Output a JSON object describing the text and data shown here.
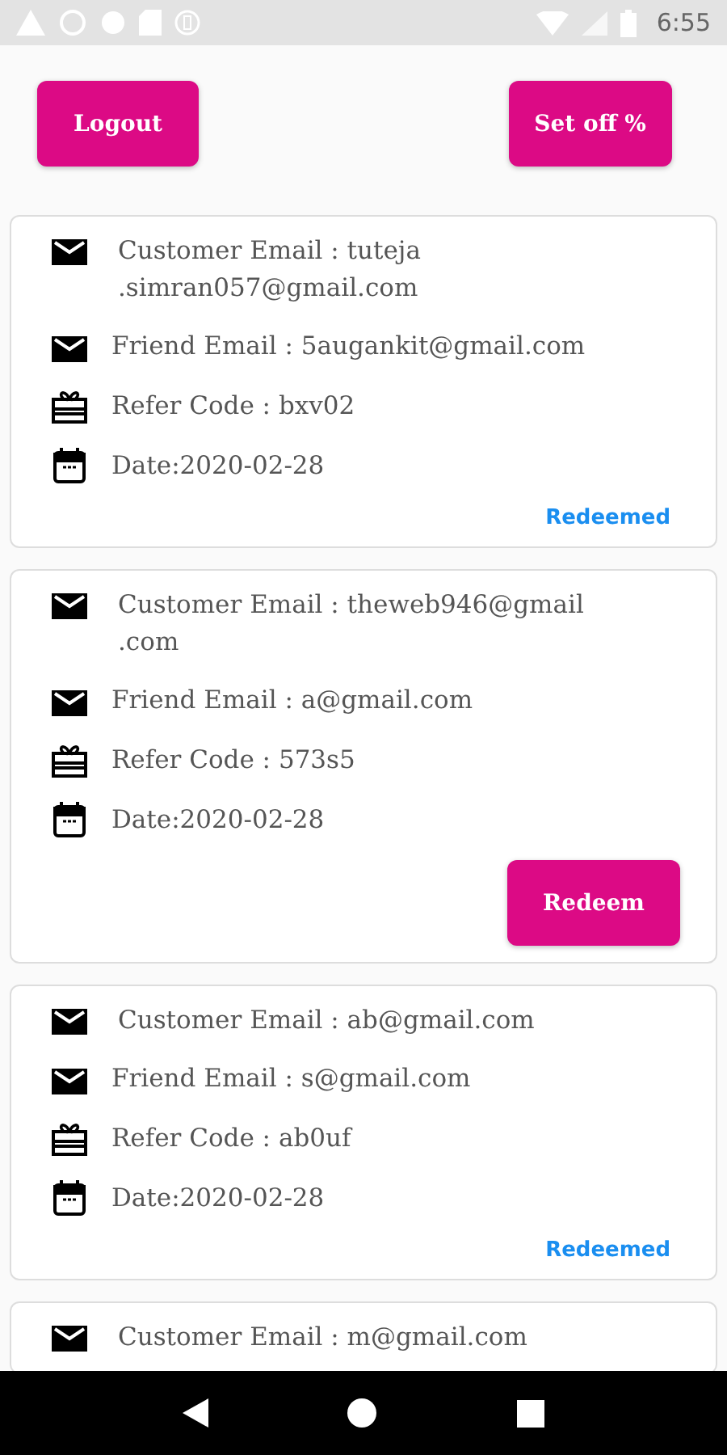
{
  "status_bar": {
    "time": "6:55"
  },
  "header": {
    "buttons": [
      "Logout",
      "Set off %"
    ]
  },
  "referrals": [
    {
      "customer_email": "Customer Email : tuteja .simran057@gmail.com",
      "friend_email": "Friend Email : 5augankit@gmail.com",
      "refer_code": "Refer Code : bxv02",
      "date": "Date:2020-02-28",
      "action": {
        "kind": "status",
        "label": "Redeemed"
      }
    },
    {
      "customer_email": "Customer Email : theweb946@gmail .com",
      "friend_email": "Friend Email : a@gmail.com",
      "refer_code": "Refer Code : 573s5",
      "date": "Date:2020-02-28",
      "action": {
        "kind": "button",
        "label": "Redeem"
      }
    },
    {
      "customer_email": "Customer Email : ab@gmail.com",
      "friend_email": "Friend Email : s@gmail.com",
      "refer_code": "Refer Code : ab0uf",
      "date": "Date:2020-02-28",
      "action": {
        "kind": "status",
        "label": "Redeemed"
      }
    },
    {
      "customer_email": "Customer Email : m@gmail.com"
    }
  ]
}
